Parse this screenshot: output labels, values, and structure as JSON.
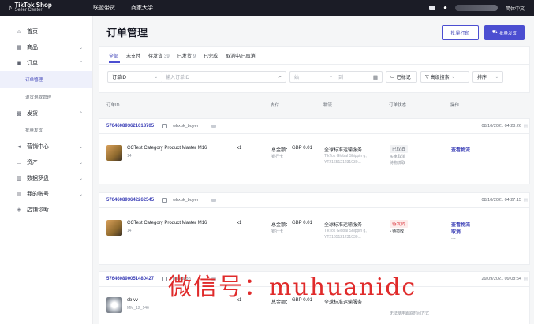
{
  "topbar": {
    "logo_icon": "tiktok-note-icon",
    "brand_title": "TikTok Shop",
    "brand_sub": "Seller Center",
    "nav": [
      "联盟带货",
      "商家大学"
    ],
    "language": "简体中文"
  },
  "sidebar": {
    "items": [
      {
        "label": "首页",
        "icon": "home-icon",
        "glyph": "⌂",
        "chevron": ""
      },
      {
        "label": "商品",
        "icon": "box-icon",
        "glyph": "▦",
        "chevron": "⌄"
      },
      {
        "label": "订单",
        "icon": "order-icon",
        "glyph": "▣",
        "chevron": "⌃"
      },
      {
        "label": "发货",
        "icon": "truck-icon",
        "glyph": "▩",
        "chevron": "⌃"
      },
      {
        "label": "营销中心",
        "icon": "megaphone-icon",
        "glyph": "◂",
        "chevron": "⌄"
      },
      {
        "label": "资产",
        "icon": "wallet-icon",
        "glyph": "▭",
        "chevron": "⌄"
      },
      {
        "label": "数据罗盘",
        "icon": "chart-icon",
        "glyph": "▥",
        "chevron": "⌄"
      },
      {
        "label": "我的账号",
        "icon": "account-icon",
        "glyph": "▤",
        "chevron": "⌄"
      },
      {
        "label": "店铺诊断",
        "icon": "shield-icon",
        "glyph": "◈",
        "chevron": ""
      }
    ],
    "order_sub": [
      "订单管理",
      "退货退款管理"
    ],
    "ship_sub": [
      "批量发货"
    ]
  },
  "header": {
    "title": "订单管理",
    "print_button": "批量打印",
    "ship_button": "批量发货",
    "ship_icon": "truck-icon"
  },
  "tabs": [
    {
      "label": "全部",
      "count": ""
    },
    {
      "label": "未支付",
      "count": ""
    },
    {
      "label": "待发货",
      "count": "39"
    },
    {
      "label": "已发货",
      "count": "9"
    },
    {
      "label": "已完成",
      "count": ""
    },
    {
      "label": "取消中/已取消",
      "count": ""
    }
  ],
  "filters": {
    "id_select": "订单ID",
    "id_placeholder": "输入订单ID",
    "date_start": "始",
    "date_sep": "-",
    "date_end": "到",
    "marked": "已标记",
    "advanced": "高级搜索",
    "sort": "排序"
  },
  "table_headers": [
    "订单ID",
    "支付",
    "物流",
    "订单状态",
    "操作"
  ],
  "orders": [
    {
      "id": "576460893621618705",
      "buyer": "wbxuk_buyer",
      "time": "08/10/2021 04:28:26",
      "product": "CCTest Category Product Master M16",
      "sku": "14",
      "qty": "x1",
      "total_label": "总金额：",
      "total": "GBP 0.01",
      "pay_method": "银行卡",
      "ship": "全球标准运输服务",
      "ship_sub": "TikTok Global Shippin g, YT2165121231030...",
      "status": "已取消",
      "status_sub": [
        "买家取消",
        "待物流取"
      ],
      "actions": [
        "查看物流"
      ]
    },
    {
      "id": "576460893642262545",
      "buyer": "wbxuk_buyer",
      "time": "08/10/2021 04:27:15",
      "product": "CCTest Category Product Master M16",
      "sku": "14",
      "qty": "x1",
      "total_label": "总金额：",
      "total": "GBP 0.01",
      "pay_method": "银行卡",
      "ship": "全球标准运输服务",
      "ship_sub": "TikTok Global Shippin g, YT2165121231030...",
      "status": "待发货",
      "status_sub": [
        "• 待揽收"
      ],
      "actions": [
        "查看物流",
        "取消",
        "..."
      ]
    },
    {
      "id": "576460890051480427",
      "buyer": "bengston",
      "time": "29/09/2021 09:08:54",
      "product": "cb vv",
      "sku": "MM_12_146",
      "qty": "x1",
      "total_label": "总金额：",
      "total": "GBP 0.01",
      "pay_method": "",
      "ship": "全球标准运输服务",
      "ship_sub": "",
      "status": "",
      "status_sub": [
        "无法使用跟踪时间方式"
      ],
      "actions": []
    }
  ],
  "watermark": "微信号：muhuanidc"
}
